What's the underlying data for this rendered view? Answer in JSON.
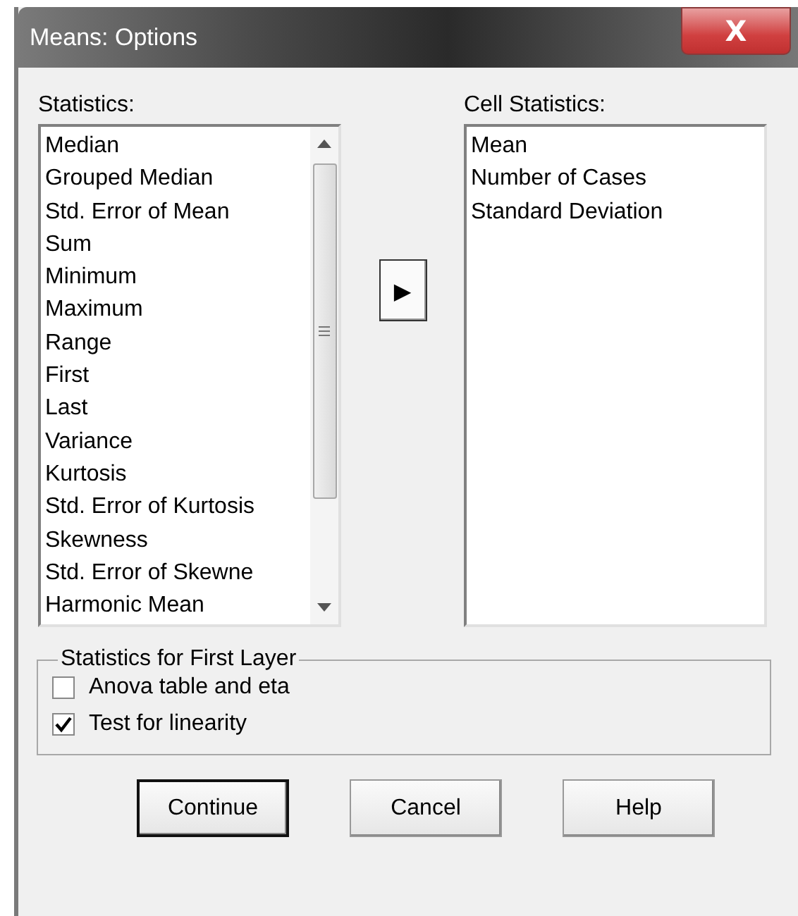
{
  "window": {
    "title": "Means: Options",
    "close": "X"
  },
  "statistics": {
    "label": "Statistics:",
    "items": [
      "Median",
      "Grouped Median",
      "Std. Error of Mean",
      "Sum",
      "Minimum",
      "Maximum",
      "Range",
      "First",
      "Last",
      "Variance",
      "Kurtosis",
      "Std. Error of Kurtosis",
      "Skewness",
      "Std. Error of Skewne",
      "Harmonic Mean"
    ]
  },
  "move_button": {
    "glyph": "▶"
  },
  "cell_statistics": {
    "label": "Cell Statistics:",
    "items": [
      "Mean",
      "Number of Cases",
      "Standard Deviation"
    ]
  },
  "first_layer": {
    "title": "Statistics for First Layer",
    "options": [
      {
        "label": "Anova table and eta",
        "checked": false
      },
      {
        "label": "Test for linearity",
        "checked": true
      }
    ]
  },
  "buttons": [
    {
      "label": "Continue",
      "default": true
    },
    {
      "label": "Cancel",
      "default": false
    },
    {
      "label": "Help",
      "default": false
    }
  ]
}
